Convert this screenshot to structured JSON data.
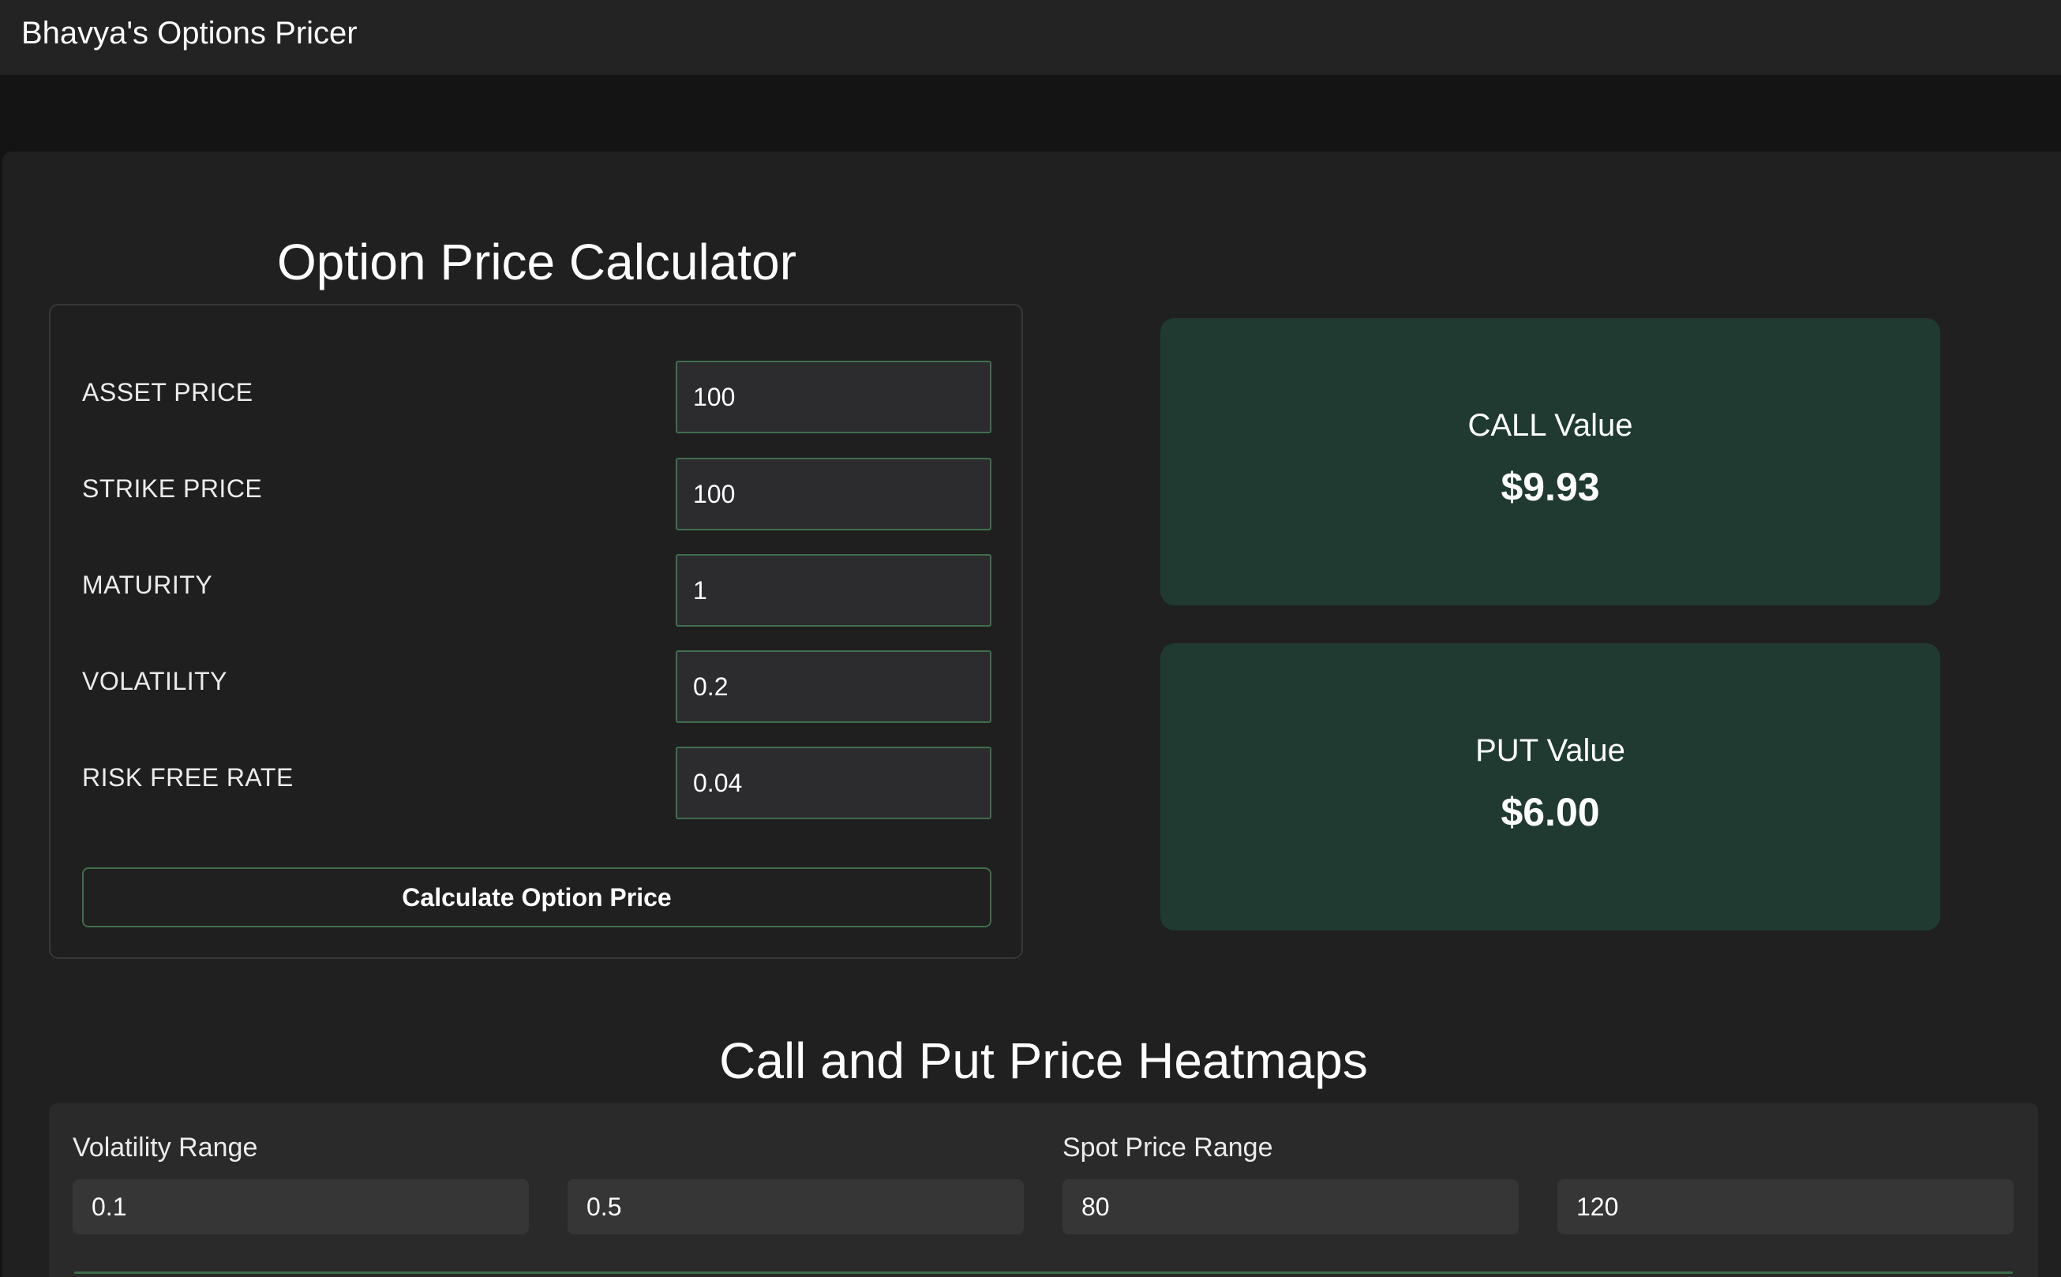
{
  "app": {
    "title": "Bhavya's Options Pricer"
  },
  "calculator": {
    "title": "Option Price Calculator",
    "fields": [
      {
        "label": "ASSET PRICE",
        "value": "100"
      },
      {
        "label": "STRIKE PRICE",
        "value": "100"
      },
      {
        "label": "MATURITY",
        "value": "1"
      },
      {
        "label": "VOLATILITY",
        "value": "0.2"
      },
      {
        "label": "RISK FREE RATE",
        "value": "0.04"
      }
    ],
    "button_label": "Calculate Option Price"
  },
  "results": {
    "call": {
      "label": "CALL Value",
      "value": "$9.93"
    },
    "put": {
      "label": "PUT Value",
      "value": "$6.00"
    }
  },
  "heatmaps": {
    "title": "Call and Put Price Heatmaps",
    "volatility_range": {
      "label": "Volatility Range",
      "min": "0.1",
      "max": "0.5"
    },
    "spot_price_range": {
      "label": "Spot Price Range",
      "min": "80",
      "max": "120"
    }
  },
  "colors": {
    "background": "#141414",
    "panel": "#202020",
    "topbar": "#232323",
    "accent_border": "#3f6e4c",
    "result_card": "#203a32"
  }
}
